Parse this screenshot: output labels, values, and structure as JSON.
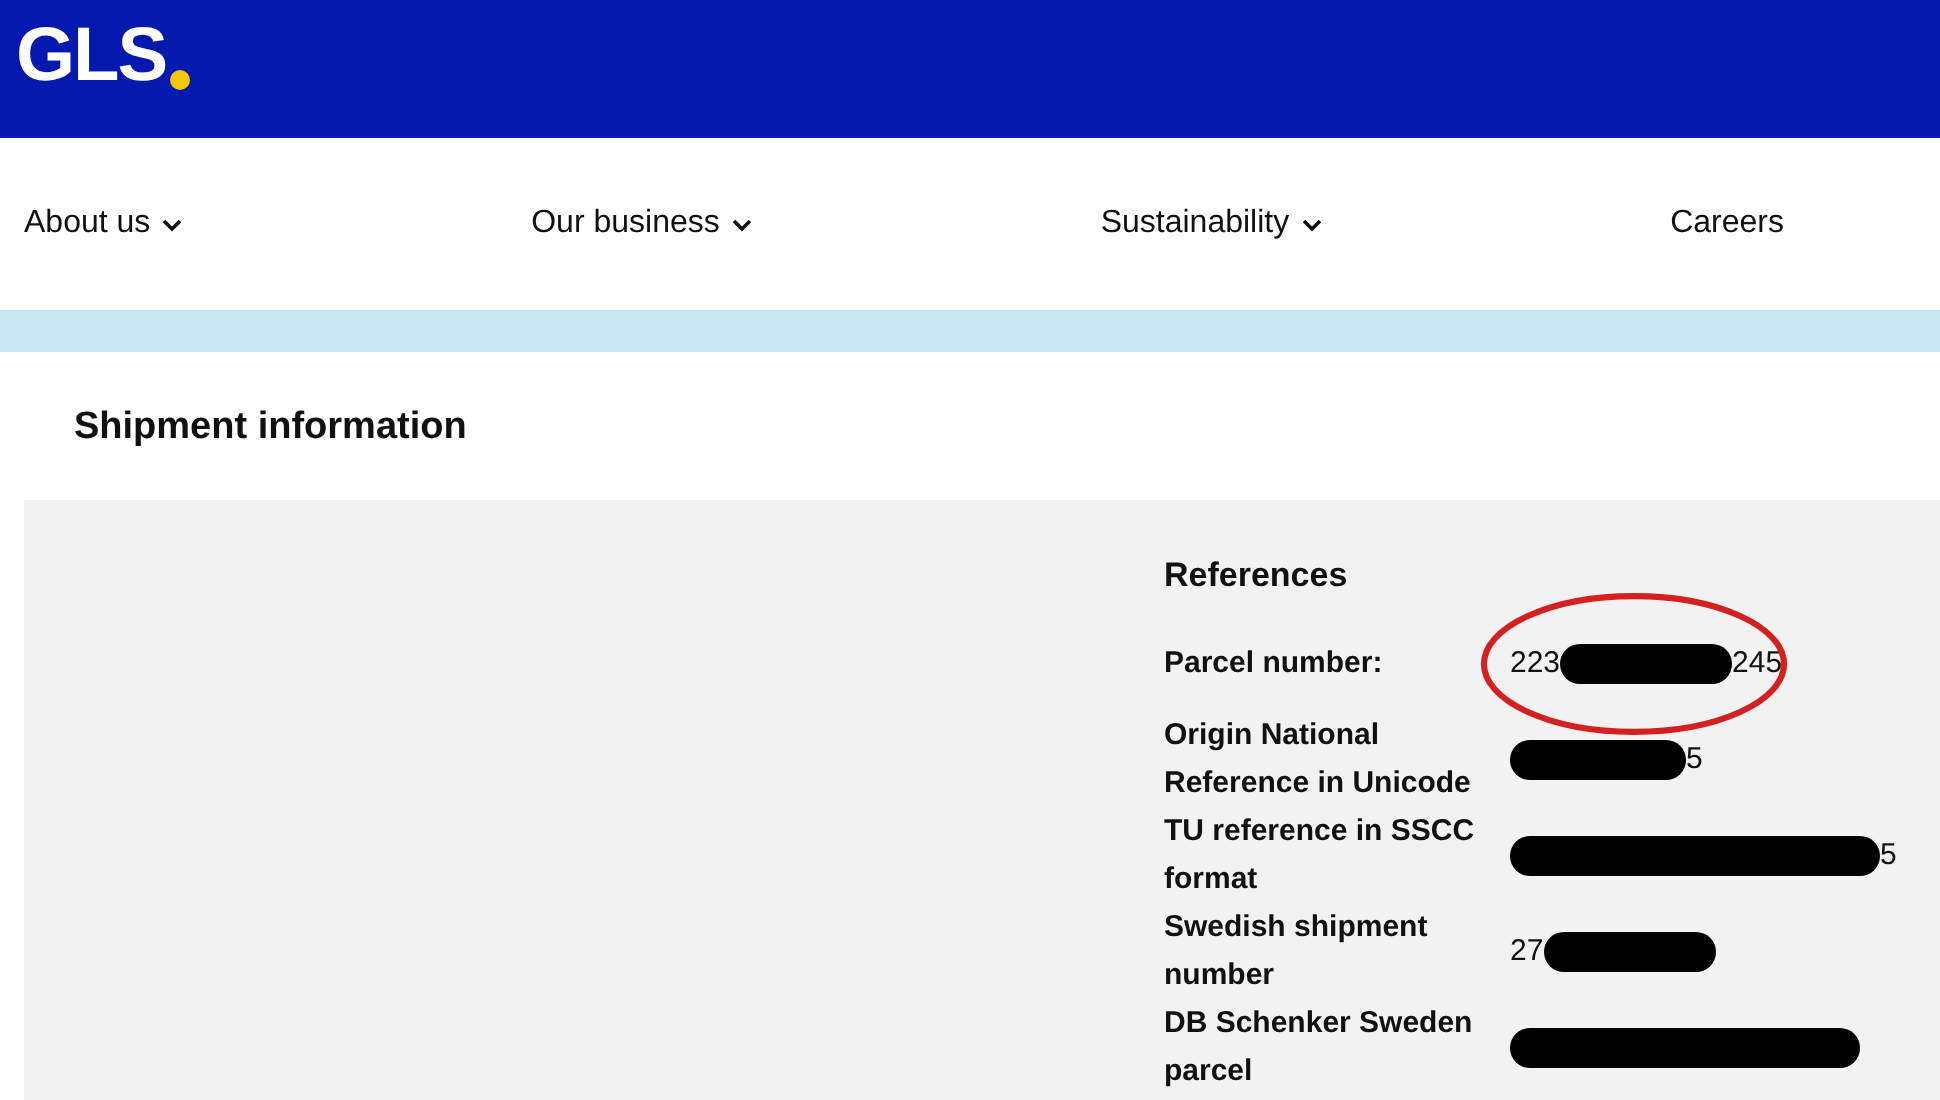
{
  "header": {
    "logo": "GLS"
  },
  "nav": [
    {
      "label": "About us",
      "has_menu": true
    },
    {
      "label": "Our business",
      "has_menu": true
    },
    {
      "label": "Sustainability",
      "has_menu": true
    },
    {
      "label": "Careers",
      "has_menu": false
    }
  ],
  "section": {
    "title": "Shipment information"
  },
  "references": {
    "title": "References",
    "rows": [
      {
        "label": "Parcel number:",
        "circled": true,
        "parts": [
          {
            "kind": "text",
            "text": "223"
          },
          {
            "kind": "redaction"
          },
          {
            "kind": "text",
            "text": "245"
          }
        ]
      },
      {
        "label": "Origin National Reference in Unicode",
        "circled": false,
        "parts": [
          {
            "kind": "redaction"
          },
          {
            "kind": "text",
            "text": "5"
          }
        ]
      },
      {
        "label": "TU reference in SSCC format",
        "circled": false,
        "parts": [
          {
            "kind": "redaction"
          },
          {
            "kind": "text",
            "text": "5"
          }
        ]
      },
      {
        "label": "Swedish shipment number",
        "circled": false,
        "parts": [
          {
            "kind": "text",
            "text": "27"
          },
          {
            "kind": "redaction"
          }
        ]
      },
      {
        "label": "DB Schenker Sweden parcel",
        "circled": false,
        "parts": [
          {
            "kind": "redaction"
          }
        ]
      }
    ]
  }
}
